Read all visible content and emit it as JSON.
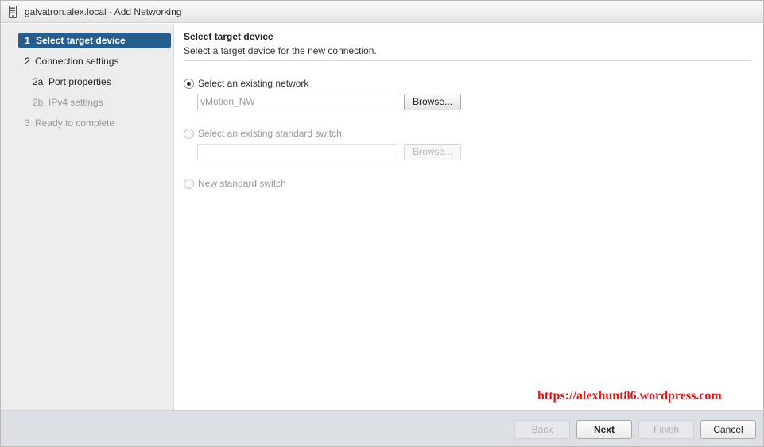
{
  "window": {
    "title": "galvatron.alex.local - Add Networking",
    "icon": "server-icon"
  },
  "sidebar": {
    "steps": [
      {
        "num": "1",
        "label": "Select target device",
        "state": "active"
      },
      {
        "num": "2",
        "label": "Connection settings",
        "state": "enabled"
      },
      {
        "num": "2a",
        "label": "Port properties",
        "state": "enabled"
      },
      {
        "num": "2b",
        "label": "IPv4 settings",
        "state": "disabled"
      },
      {
        "num": "3",
        "label": "Ready to complete",
        "state": "disabled"
      }
    ]
  },
  "content": {
    "title": "Select target device",
    "subtitle": "Select a target device for the new connection.",
    "options": [
      {
        "label": "Select an existing network",
        "checked": true,
        "disabled": false,
        "field_value": "vMotion_NW",
        "browse_label": "Browse..."
      },
      {
        "label": "Select an existing standard switch",
        "checked": false,
        "disabled": true,
        "field_value": "",
        "browse_label": "Browse..."
      },
      {
        "label": "New standard switch",
        "checked": false,
        "disabled": true
      }
    ]
  },
  "watermark": "https://alexhunt86.wordpress.com",
  "footer": {
    "back_label": "Back",
    "next_label": "Next",
    "finish_label": "Finish",
    "cancel_label": "Cancel"
  },
  "colors": {
    "active_step": "#265d8c",
    "watermark": "#e0151b",
    "footer_bg": "#dcdfe3"
  }
}
